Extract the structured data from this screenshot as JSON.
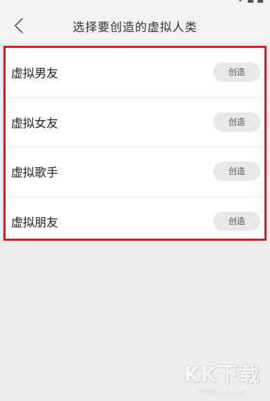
{
  "header": {
    "title": "选择要创造的虚拟人类"
  },
  "icons": {
    "back": "chevron-left-icon"
  },
  "list": {
    "items": [
      {
        "label": "虚拟男友",
        "button": "创造"
      },
      {
        "label": "虚拟女友",
        "button": "创造"
      },
      {
        "label": "虚拟歌手",
        "button": "创造"
      },
      {
        "label": "虚拟朋友",
        "button": "创造"
      }
    ]
  },
  "watermark": {
    "logo": "KK下载",
    "url": "www.kkx.net"
  },
  "colors": {
    "highlight_border": "#e0141e",
    "background": "#ececec",
    "button_bg": "#e8e8e8"
  }
}
